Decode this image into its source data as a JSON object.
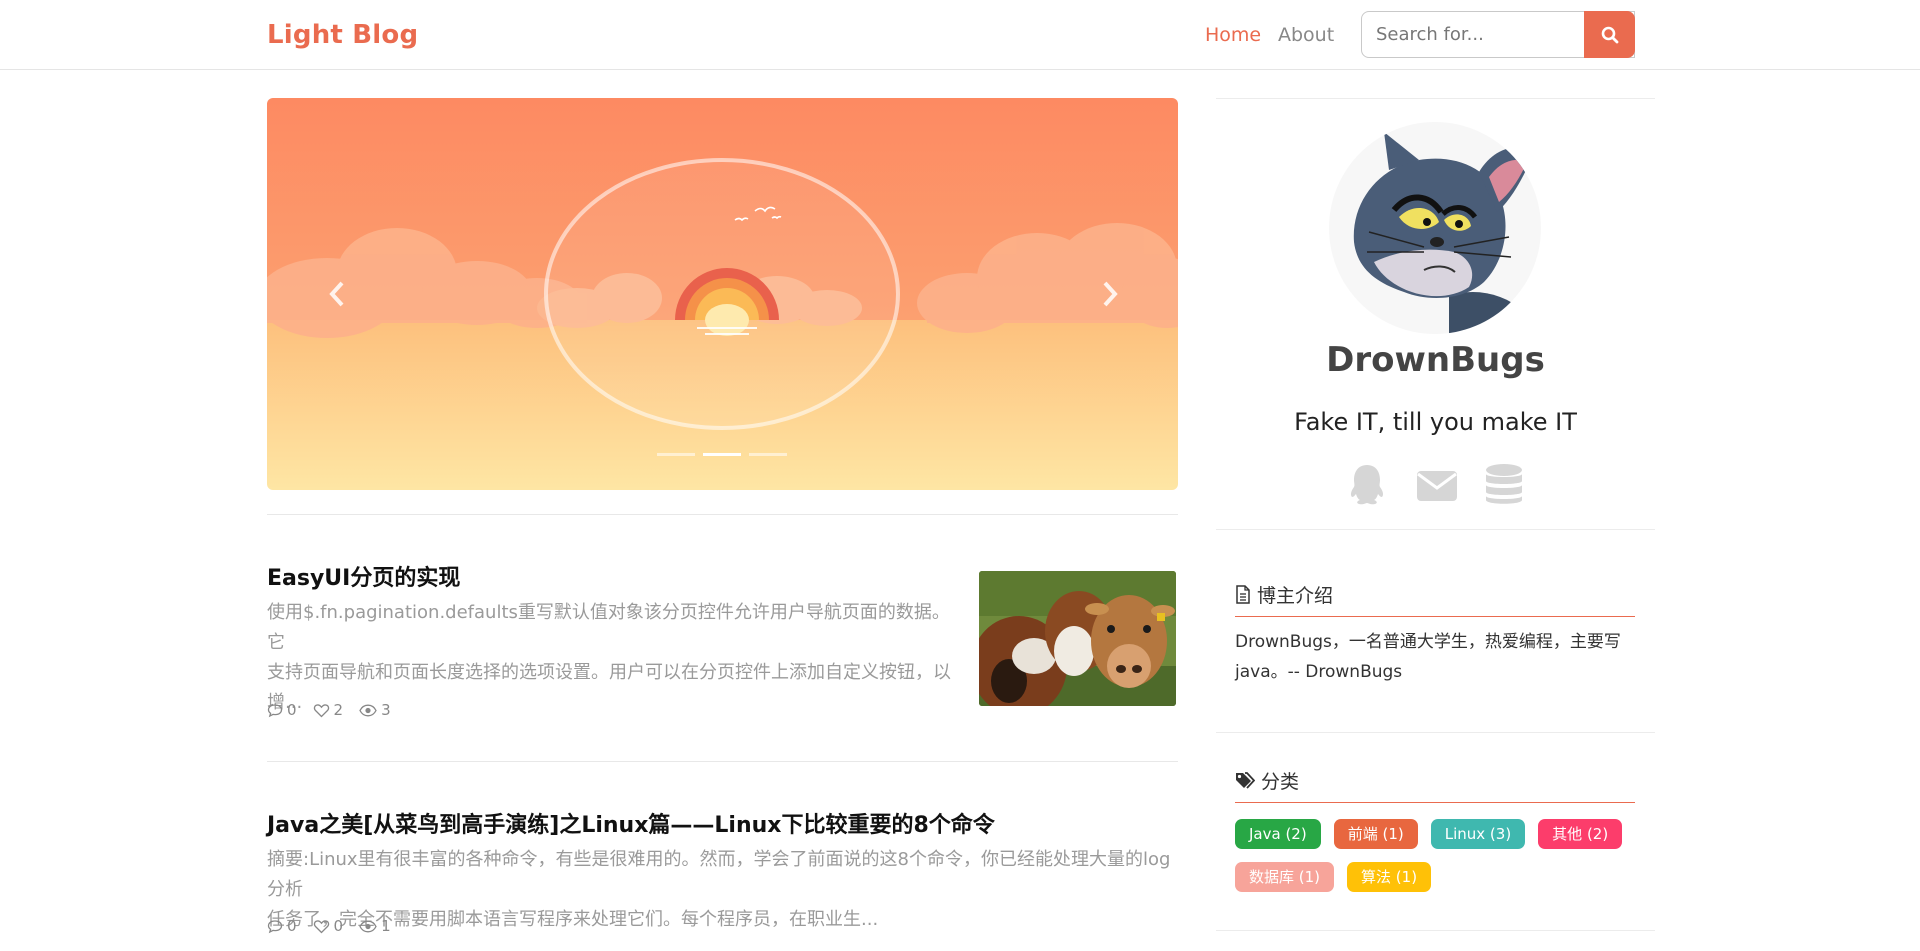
{
  "header": {
    "brand": "Light Blog",
    "nav": [
      {
        "label": "Home",
        "active": true
      },
      {
        "label": "About",
        "active": false
      }
    ],
    "search_placeholder": "Search for...",
    "search_icon": "search-icon",
    "accent_color": "#ea6b4f"
  },
  "carousel": {
    "prev_icon": "chevron-left-icon",
    "next_icon": "chevron-right-icon",
    "slides": 3,
    "active_slide": 2,
    "scene": "sunset-over-sea"
  },
  "posts": [
    {
      "title": "EasyUI分页的实现",
      "excerpt_lines": [
        "使用$.fn.pagination.defaults重写默认值对象该分页控件允许用户导航页面的数据。它",
        "支持页面导航和页面长度选择的选项设置。用户可以在分页控件上添加自定义按钮，以",
        "增..."
      ],
      "comments": "0",
      "likes": "2",
      "views": "3",
      "has_thumbnail": true,
      "thumbnail_subject": "cows"
    },
    {
      "title": "Java之美[从菜鸟到高手演练]之Linux篇——Linux下比较重要的8个命令",
      "excerpt_lines": [
        "摘要:Linux里有很丰富的各种命令，有些是很难用的。然而，学会了前面说的这8个命令，你已经能处理大量的log分析",
        "任务了，完全不需要用脚本语言写程序来处理它们。每个程序员，在职业生..."
      ],
      "comments": "0",
      "likes": "0",
      "views": "1",
      "has_thumbnail": false
    }
  ],
  "sidebar": {
    "author": "DrownBugs",
    "motto": "Fake IT, till you make IT",
    "social_icons": [
      "qq-icon",
      "envelope-icon",
      "database-icon"
    ],
    "intro": {
      "title": "博主介绍",
      "text": "DrownBugs，一名普通大学生，热爱编程，主要写java。-- DrownBugs"
    },
    "categories": {
      "title": "分类",
      "tags": [
        {
          "label": "Java (2)",
          "color": "#28a745"
        },
        {
          "label": "前端 (1)",
          "color": "#e8673f"
        },
        {
          "label": "Linux (3)",
          "color": "#3fb8af"
        },
        {
          "label": "其他 (2)",
          "color": "#fc3d6b"
        },
        {
          "label": "数据库 (1)",
          "color": "#f7a49a"
        },
        {
          "label": "算法 (1)",
          "color": "#ffc107"
        }
      ]
    }
  }
}
